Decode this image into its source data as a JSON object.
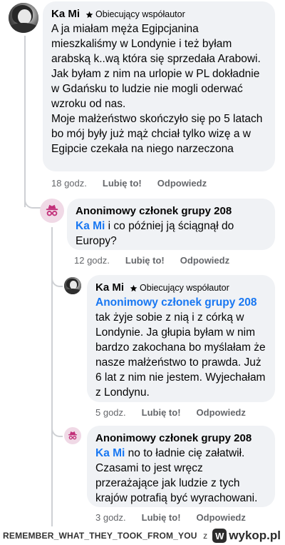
{
  "comments": [
    {
      "author": "Ka Mi",
      "badge": "Obiecujący współautor",
      "mention": "",
      "text": "A ja miałam męża Egipcjanina mieszkaliśmy w Londynie i też byłam arabską k..wą która się sprzedała Arabowi. Jak byłam z nim na urlopie w PL dokładnie w  Gdańsku to ludzie nie mogli oderwać wzroku od nas.\nMoje małżeństwo skończyło się po 5 latach bo mój były już mąż chciał tylko wizę a w Egipcie czekała na niego narzeczona",
      "time": "18 godz.",
      "like": "Lubię to!",
      "reply": "Odpowiedz"
    },
    {
      "author": "Anonimowy członek grupy 208",
      "badge": "",
      "mention": "Ka Mi",
      "text": " i co później ją ściągnął do Europy?",
      "time": "12 godz.",
      "like": "Lubię to!",
      "reply": "Odpowiedz"
    },
    {
      "author": "Ka Mi",
      "badge": "Obiecujący współautor",
      "mention": "Anonimowy członek grupy 208",
      "text": "tak żyje sobie z nią i z córką w Londynie. Ja głupia byłam w nim bardzo zakochana bo myślałam że nasze małżeństwo to prawda. Już 6 lat z nim nie jestem. Wyjechałam z Londynu.",
      "time": "5 godz.",
      "like": "Lubię to!",
      "reply": "Odpowiedz"
    },
    {
      "author": "Anonimowy członek grupy 208",
      "badge": "",
      "mention": "Ka Mi",
      "text": " no to ładnie cię załatwił. Czasami to jest wręcz przerażające jak ludzie z tych krajów potrafią być wyrachowani.",
      "time": "3 godz.",
      "like": "Lubię to!",
      "reply": "Odpowiedz"
    }
  ],
  "footer": {
    "user": "REMEMBER_WHAT_THEY_TOOK_FROM_YOU",
    "separator": "z",
    "brand": "wykop.pl",
    "logo_letter": "W"
  },
  "colors": {
    "bubble": "#f0f2f5",
    "mention": "#1877f2",
    "meta": "#65676b",
    "anon_avatar_bg": "#f0d9e6",
    "anon_icon": "#c2307a"
  },
  "icons": {
    "badge": "star-icon",
    "anonymous": "anonymous-member-icon"
  }
}
